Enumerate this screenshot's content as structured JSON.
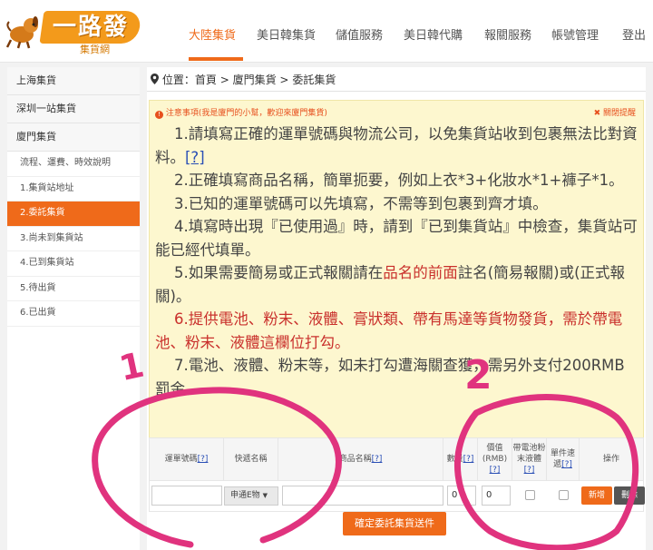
{
  "logo": {
    "brand": "一路發",
    "sub": "集貨網"
  },
  "nav": {
    "items": [
      "大陸集貨",
      "美日韓集貨",
      "儲值服務",
      "美日韓代購",
      "報關服務",
      "帳號管理",
      "登出"
    ],
    "active_index": 0
  },
  "sidebar": {
    "groups": [
      "上海集貨",
      "深圳一站集貨",
      "廈門集貨"
    ],
    "sub_items": [
      "流程、運費、時效說明",
      "1.集貨站地址",
      "2.委託集貨",
      "3.尚未到集貨站",
      "4.已到集貨站",
      "5.待出貨",
      "6.已出貨"
    ],
    "active_sub_index": 2
  },
  "breadcrumb": {
    "prefix": "位置：",
    "home": "首頁",
    "section": "廈門集貨",
    "current": "委託集貨",
    "sep": ">"
  },
  "notice": {
    "title": "注意事項(我是廈門的小幫，歡迎來廈門集貨)",
    "close": "關閉提醒",
    "l1": "1.請填寫正確的運單號碼與物流公司，以免集貨站收到包裹無法比對資料。",
    "l2": "2.正確填寫商品名稱，簡單扼要，例如上衣*3+化妝水*1+褲子*1。",
    "l3": "3.已知的運單號碼可以先填寫，不需等到包裹到齊才填。",
    "l4": "4.填寫時出現『已使用過』時，請到『已到集貨站』中檢查，集貨站可能已經代填單。",
    "l5a": "5.如果需要簡易或正式報關請在",
    "l5b": "品名的前面",
    "l5c": "註名(簡易報關)或(正式報關)。",
    "l6": "6.提供電池、粉末、液體、膏狀類、帶有馬達等貨物發貨，需於帶電池、粉末、液體這欄位打勾。",
    "l7": "7.電池、液體、粉末等，如未打勾遭海關查獲，需另外支付200RMB罰金。",
    "help": "[?]"
  },
  "table": {
    "headers": {
      "tracking": "運單號碼",
      "courier": "快遞名稱",
      "product": "商品名稱",
      "qty": "數量",
      "value": "價值(RMB)",
      "battery": "帶電池粉末液體",
      "single": "單件速遞",
      "action": "操作"
    },
    "help": "[?]",
    "row": {
      "tracking": "",
      "courier": "申通E物",
      "product": "",
      "qty": "0",
      "value": "0"
    },
    "add": "新增",
    "delete": "刪除"
  },
  "submit": "確定委託集貨送件",
  "colors": {
    "accent": "#ef6a1a",
    "notice_bg": "#fdf7cf",
    "ink": "#e0337e",
    "alert_red": "#c9302c"
  },
  "annotations": {
    "label_1": "1",
    "label_2": "2"
  }
}
